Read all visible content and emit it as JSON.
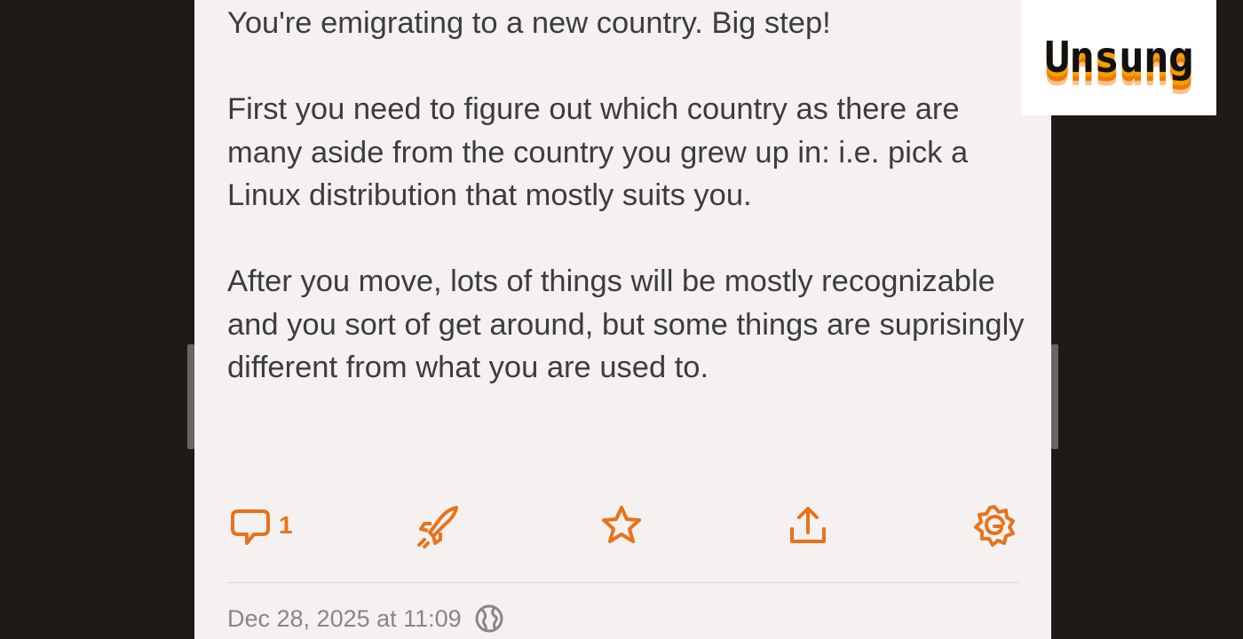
{
  "post": {
    "paragraphs": [
      "You're emigrating to a new country. Big step!",
      "First you need to figure out which country as there are many aside from the country you grew up in: i.e. pick a Linux distribution that mostly suits you.",
      "After you move, lots of things will be mostly recognizable and you sort of get around, but some things are suprisingly different from what you are used to."
    ],
    "timestamp": "Dec 28, 2025 at 11:09"
  },
  "actions": {
    "reply_count": "1",
    "icons": [
      "reply-icon",
      "boost-icon",
      "favorite-icon",
      "share-icon",
      "settings-icon"
    ]
  },
  "watermark": {
    "text": "Unsung"
  },
  "colors": {
    "accent": "#e8731c",
    "card_bg": "#f5f1f1",
    "page_bg": "#1f1917",
    "text": "#3d3c3c",
    "meta_text": "#8a8686"
  }
}
